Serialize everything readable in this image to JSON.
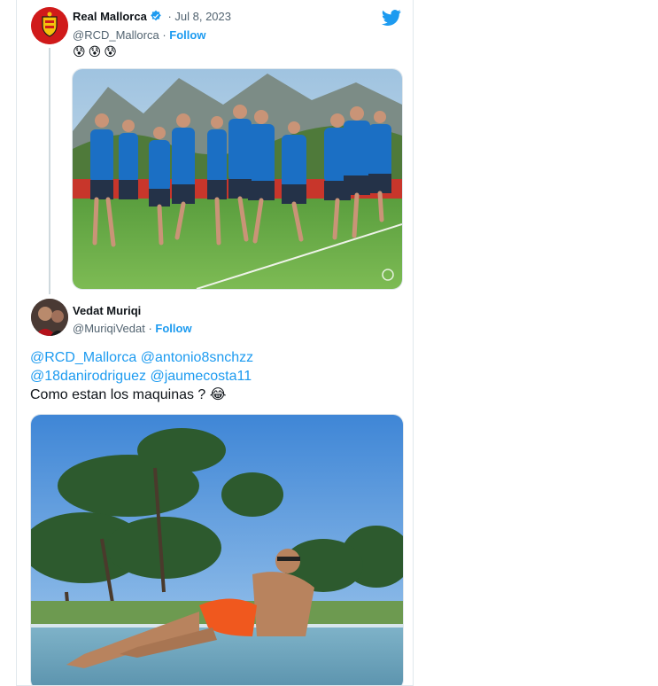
{
  "tweet1": {
    "name": "Real Mallorca",
    "date": "· Jul 8, 2023",
    "handle": "@RCD_Mallorca ·",
    "follow_label": "Follow",
    "emojis": "😰😰😰"
  },
  "tweet2": {
    "name": "Vedat Muriqi",
    "handle": "@MuriqiVedat ·",
    "follow_label": "Follow",
    "mentions_line1_a": "@RCD_Mallorca",
    "mentions_line1_b": "@antonio8snchzz",
    "mentions_line2_a": "@18danirodriguez",
    "mentions_line2_b": "@jaumecosta11",
    "text": "Como estan los maquinas ? 😂"
  },
  "colors": {
    "accent": "#1d9bf0",
    "mallorca_red": "#d01a1a",
    "kit_blue": "#1b6fc4"
  },
  "icons": {
    "brand": "twitter-bird-icon",
    "verified": "verified-badge-icon"
  }
}
